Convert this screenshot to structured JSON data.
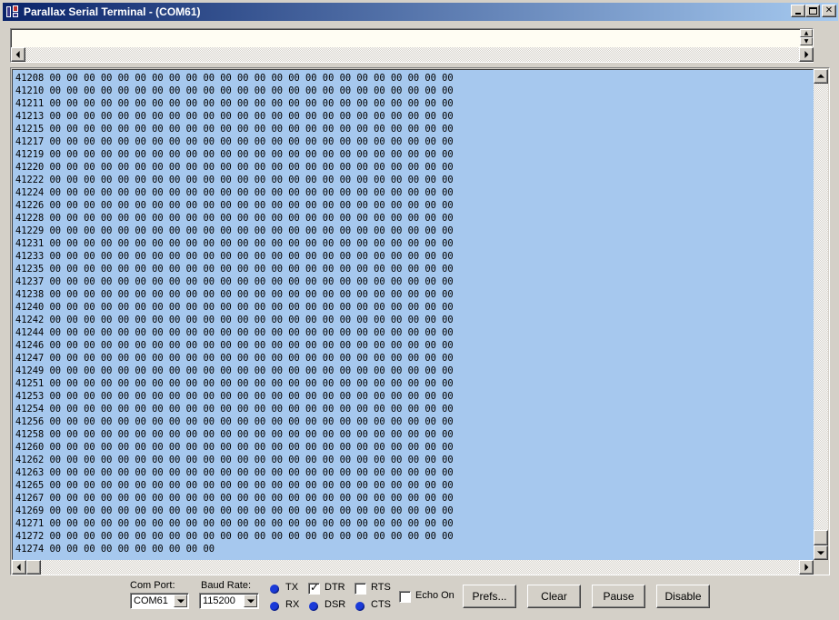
{
  "window": {
    "title": "Parallax Serial Terminal - (COM61)",
    "minimize_glyph": "_",
    "maximize_glyph": "□",
    "close_glyph": "✕"
  },
  "receive": {
    "lines": [
      "41208 00 00 00 00 00 00 00 00 00 00 00 00 00 00 00 00 00 00 00 00 00 00 00 00 ",
      "41210 00 00 00 00 00 00 00 00 00 00 00 00 00 00 00 00 00 00 00 00 00 00 00 00 ",
      "41211 00 00 00 00 00 00 00 00 00 00 00 00 00 00 00 00 00 00 00 00 00 00 00 00 ",
      "41213 00 00 00 00 00 00 00 00 00 00 00 00 00 00 00 00 00 00 00 00 00 00 00 00 ",
      "41215 00 00 00 00 00 00 00 00 00 00 00 00 00 00 00 00 00 00 00 00 00 00 00 00 ",
      "41217 00 00 00 00 00 00 00 00 00 00 00 00 00 00 00 00 00 00 00 00 00 00 00 00 ",
      "41219 00 00 00 00 00 00 00 00 00 00 00 00 00 00 00 00 00 00 00 00 00 00 00 00 ",
      "41220 00 00 00 00 00 00 00 00 00 00 00 00 00 00 00 00 00 00 00 00 00 00 00 00 ",
      "41222 00 00 00 00 00 00 00 00 00 00 00 00 00 00 00 00 00 00 00 00 00 00 00 00 ",
      "41224 00 00 00 00 00 00 00 00 00 00 00 00 00 00 00 00 00 00 00 00 00 00 00 00 ",
      "41226 00 00 00 00 00 00 00 00 00 00 00 00 00 00 00 00 00 00 00 00 00 00 00 00 ",
      "41228 00 00 00 00 00 00 00 00 00 00 00 00 00 00 00 00 00 00 00 00 00 00 00 00 ",
      "41229 00 00 00 00 00 00 00 00 00 00 00 00 00 00 00 00 00 00 00 00 00 00 00 00 ",
      "41231 00 00 00 00 00 00 00 00 00 00 00 00 00 00 00 00 00 00 00 00 00 00 00 00 ",
      "41233 00 00 00 00 00 00 00 00 00 00 00 00 00 00 00 00 00 00 00 00 00 00 00 00 ",
      "41235 00 00 00 00 00 00 00 00 00 00 00 00 00 00 00 00 00 00 00 00 00 00 00 00 ",
      "41237 00 00 00 00 00 00 00 00 00 00 00 00 00 00 00 00 00 00 00 00 00 00 00 00 ",
      "41238 00 00 00 00 00 00 00 00 00 00 00 00 00 00 00 00 00 00 00 00 00 00 00 00 ",
      "41240 00 00 00 00 00 00 00 00 00 00 00 00 00 00 00 00 00 00 00 00 00 00 00 00 ",
      "41242 00 00 00 00 00 00 00 00 00 00 00 00 00 00 00 00 00 00 00 00 00 00 00 00 ",
      "41244 00 00 00 00 00 00 00 00 00 00 00 00 00 00 00 00 00 00 00 00 00 00 00 00 ",
      "41246 00 00 00 00 00 00 00 00 00 00 00 00 00 00 00 00 00 00 00 00 00 00 00 00 ",
      "41247 00 00 00 00 00 00 00 00 00 00 00 00 00 00 00 00 00 00 00 00 00 00 00 00 ",
      "41249 00 00 00 00 00 00 00 00 00 00 00 00 00 00 00 00 00 00 00 00 00 00 00 00 ",
      "41251 00 00 00 00 00 00 00 00 00 00 00 00 00 00 00 00 00 00 00 00 00 00 00 00 ",
      "41253 00 00 00 00 00 00 00 00 00 00 00 00 00 00 00 00 00 00 00 00 00 00 00 00 ",
      "41254 00 00 00 00 00 00 00 00 00 00 00 00 00 00 00 00 00 00 00 00 00 00 00 00 ",
      "41256 00 00 00 00 00 00 00 00 00 00 00 00 00 00 00 00 00 00 00 00 00 00 00 00 ",
      "41258 00 00 00 00 00 00 00 00 00 00 00 00 00 00 00 00 00 00 00 00 00 00 00 00 ",
      "41260 00 00 00 00 00 00 00 00 00 00 00 00 00 00 00 00 00 00 00 00 00 00 00 00 ",
      "41262 00 00 00 00 00 00 00 00 00 00 00 00 00 00 00 00 00 00 00 00 00 00 00 00 ",
      "41263 00 00 00 00 00 00 00 00 00 00 00 00 00 00 00 00 00 00 00 00 00 00 00 00 ",
      "41265 00 00 00 00 00 00 00 00 00 00 00 00 00 00 00 00 00 00 00 00 00 00 00 00 ",
      "41267 00 00 00 00 00 00 00 00 00 00 00 00 00 00 00 00 00 00 00 00 00 00 00 00 ",
      "41269 00 00 00 00 00 00 00 00 00 00 00 00 00 00 00 00 00 00 00 00 00 00 00 00 ",
      "41271 00 00 00 00 00 00 00 00 00 00 00 00 00 00 00 00 00 00 00 00 00 00 00 00 ",
      "41272 00 00 00 00 00 00 00 00 00 00 00 00 00 00 00 00 00 00 00 00 00 00 00 00 ",
      "41274 00 00 00 00 00 00 00 00 00 00 "
    ],
    "background": "#a6c8ee"
  },
  "controls": {
    "com_port_label": "Com Port:",
    "com_port_value": "COM61",
    "baud_rate_label": "Baud Rate:",
    "baud_rate_value": "115200",
    "tx_label": "TX",
    "rx_label": "RX",
    "dtr_label": "DTR",
    "dtr_checked": true,
    "dsr_label": "DSR",
    "rts_label": "RTS",
    "rts_checked": false,
    "cts_label": "CTS",
    "echo_label": "Echo On",
    "echo_checked": false,
    "prefs_label": "Prefs...",
    "clear_label": "Clear",
    "pause_label": "Pause",
    "disable_label": "Disable",
    "check_mark": "✓",
    "led_color": "#1a3ad8"
  }
}
